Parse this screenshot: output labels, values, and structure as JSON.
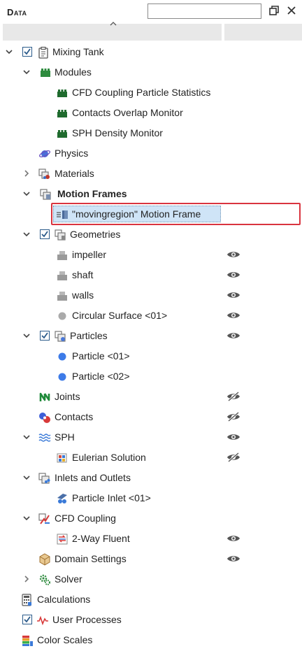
{
  "panel": {
    "title": "Data",
    "search_placeholder": ""
  },
  "tree": {
    "rows": [
      {
        "label": "Mixing Tank",
        "icon": "clipboard-icon"
      },
      {
        "label": "Modules",
        "icon": "modules-icon"
      },
      {
        "label": "CFD Coupling Particle Statistics",
        "icon": "module-icon"
      },
      {
        "label": "Contacts Overlap Monitor",
        "icon": "module-icon"
      },
      {
        "label": "SPH Density Monitor",
        "icon": "module-icon"
      },
      {
        "label": "Physics",
        "icon": "physics-icon"
      },
      {
        "label": "Materials",
        "icon": "materials-icon"
      },
      {
        "label": "Motion Frames",
        "icon": "motion-frames-icon"
      },
      {
        "label": "\"movingregion\" Motion Frame",
        "icon": "motion-frame-icon"
      },
      {
        "label": "Geometries",
        "icon": "geometries-icon"
      },
      {
        "label": "impeller",
        "icon": "geometry-icon"
      },
      {
        "label": "shaft",
        "icon": "geometry-icon"
      },
      {
        "label": "walls",
        "icon": "geometry-icon"
      },
      {
        "label": "Circular Surface <01>",
        "icon": "circle-surface-icon"
      },
      {
        "label": "Particles",
        "icon": "particles-icon"
      },
      {
        "label": "Particle <01>",
        "icon": "particle-dot-icon"
      },
      {
        "label": "Particle <02>",
        "icon": "particle-dot-icon"
      },
      {
        "label": "Joints",
        "icon": "joints-icon"
      },
      {
        "label": "Contacts",
        "icon": "contacts-icon"
      },
      {
        "label": "SPH",
        "icon": "sph-icon"
      },
      {
        "label": "Eulerian Solution",
        "icon": "eulerian-icon"
      },
      {
        "label": "Inlets and Outlets",
        "icon": "inlets-icon"
      },
      {
        "label": "Particle Inlet <01>",
        "icon": "particle-inlet-icon"
      },
      {
        "label": "CFD Coupling",
        "icon": "cfd-coupling-icon"
      },
      {
        "label": "2-Way Fluent",
        "icon": "fluent-icon"
      },
      {
        "label": "Domain Settings",
        "icon": "domain-settings-icon"
      },
      {
        "label": "Solver",
        "icon": "solver-icon"
      },
      {
        "label": "Calculations",
        "icon": "calculations-icon"
      },
      {
        "label": "User Processes",
        "icon": "user-processes-icon"
      },
      {
        "label": "Color Scales",
        "icon": "color-scales-icon"
      }
    ]
  },
  "colors": {
    "selection": "#cfe4f7",
    "highlight_outline": "#d9343f",
    "accent": "#2a5a8a"
  }
}
